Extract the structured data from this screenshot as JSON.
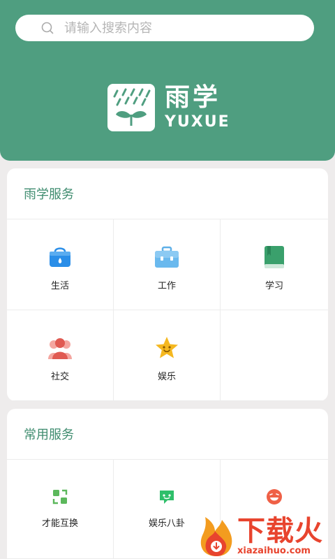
{
  "search": {
    "placeholder": "请输入搜索内容"
  },
  "brand": {
    "name_cn": "雨学",
    "name_en": "YUXUE"
  },
  "colors": {
    "header": "#4f9e80",
    "title": "#3f8c6f",
    "watermark": "#e8442e"
  },
  "section_services": {
    "title": "雨学服务",
    "items": [
      {
        "label": "生活",
        "icon": "shopping-bag-icon"
      },
      {
        "label": "工作",
        "icon": "briefcase-icon"
      },
      {
        "label": "学习",
        "icon": "book-icon"
      },
      {
        "label": "社交",
        "icon": "people-icon"
      },
      {
        "label": "娱乐",
        "icon": "star-face-icon"
      }
    ]
  },
  "section_common": {
    "title": "常用服务",
    "items": [
      {
        "label": "才能互换",
        "icon": "swap-icon"
      },
      {
        "label": "娱乐八卦",
        "icon": "chat-icon"
      },
      {
        "label": "",
        "icon": "laugh-face-icon"
      }
    ]
  },
  "watermark": {
    "cn": "下载火",
    "en": "xiazaihuo.com"
  }
}
